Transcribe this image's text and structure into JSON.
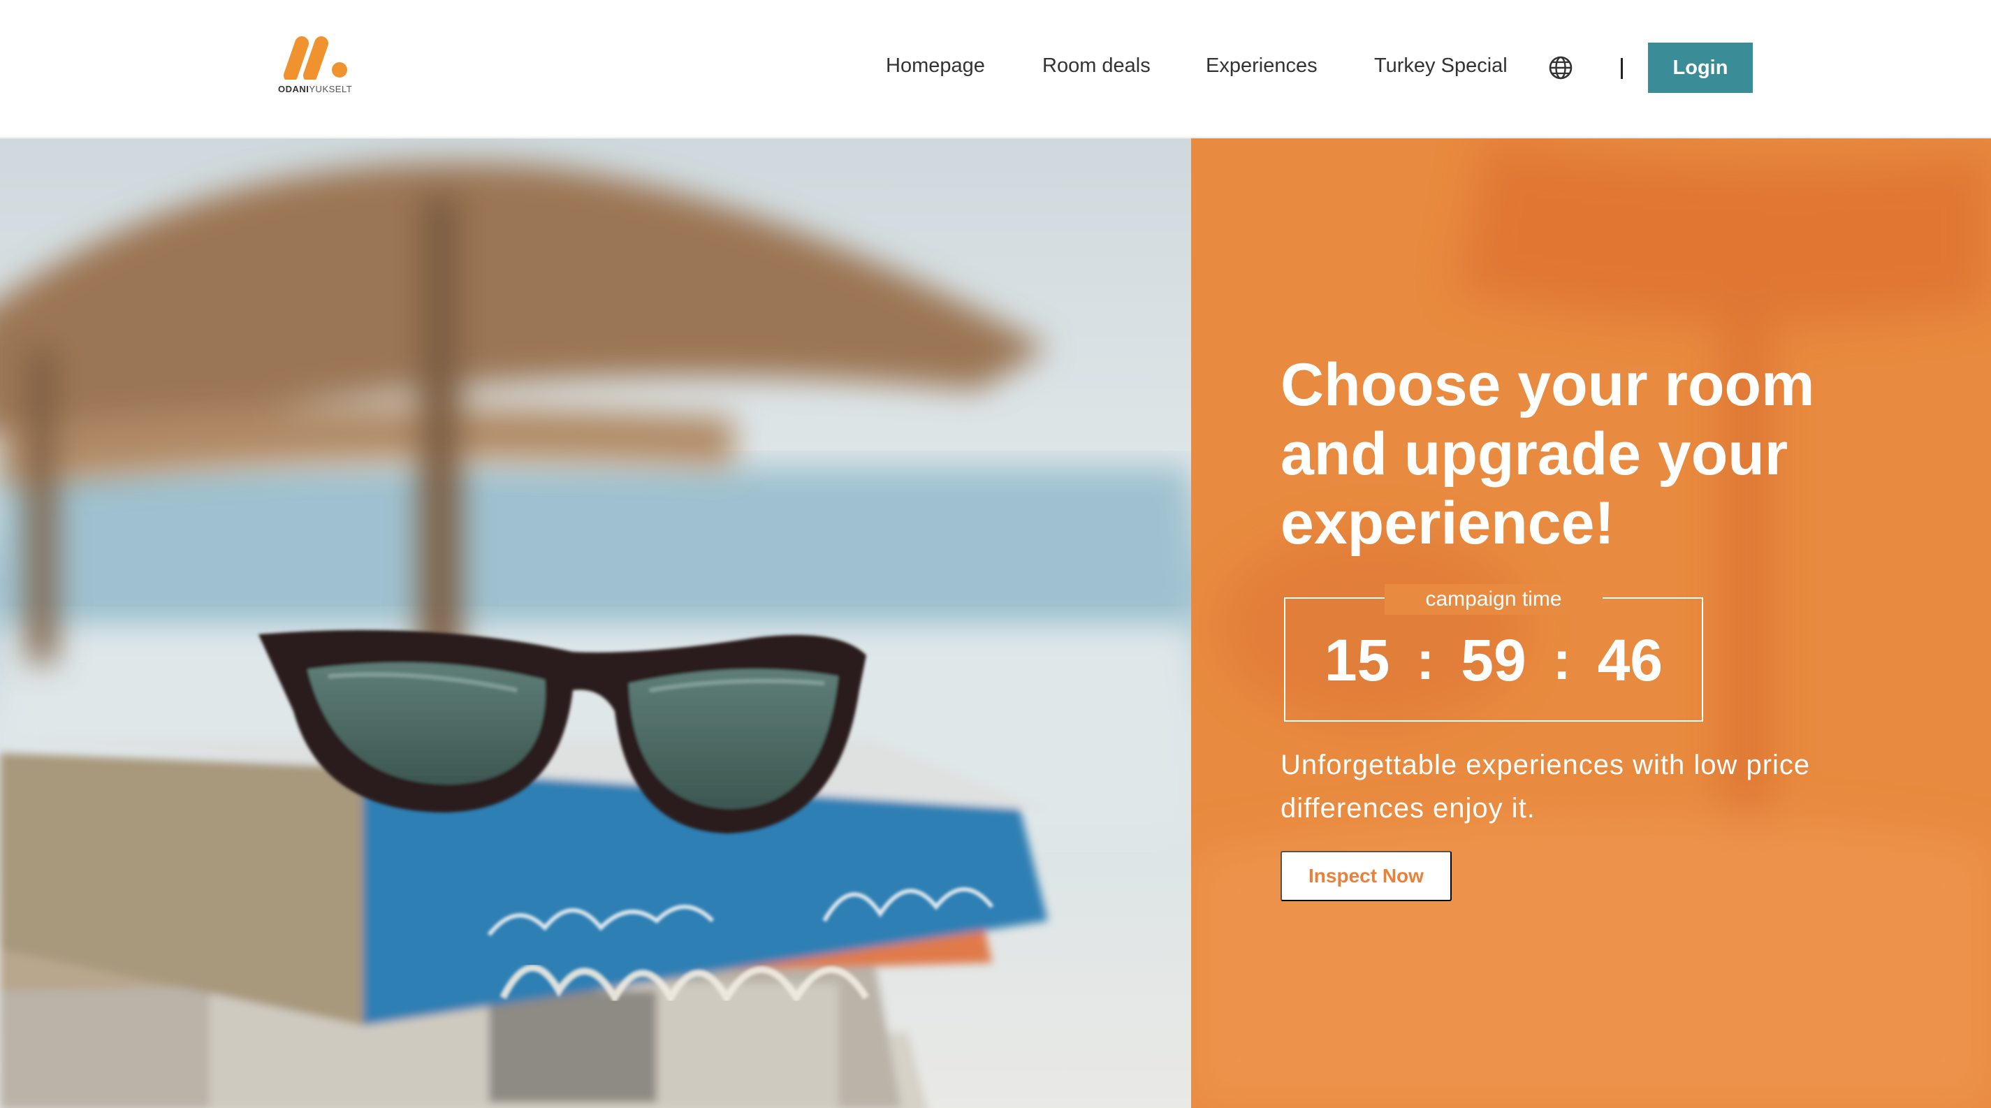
{
  "brand": {
    "logo_icon": "odani-yukselt-logo",
    "name_bold": "ODANI",
    "name_light": "YUKSELT",
    "accent_color": "#f0932f"
  },
  "nav": {
    "items": [
      {
        "label": "Homepage"
      },
      {
        "label": "Room deals"
      },
      {
        "label": "Experiences"
      },
      {
        "label": "Turkey Special"
      }
    ],
    "language_icon": "globe-icon",
    "divider": "|",
    "login_label": "Login",
    "login_color": "#3a8d96"
  },
  "hero": {
    "image_description_icon": "sunglasses-on-books-photo",
    "panel_color": "#e88a3f",
    "title": "Choose your room and upgrade your experience!",
    "timer": {
      "label": "campaign time",
      "hours": "15",
      "minutes": "59",
      "seconds": "46",
      "separator": ":"
    },
    "subtitle": "Unforgettable experiences with low price differences enjoy it.",
    "cta_label": "Inspect Now"
  }
}
